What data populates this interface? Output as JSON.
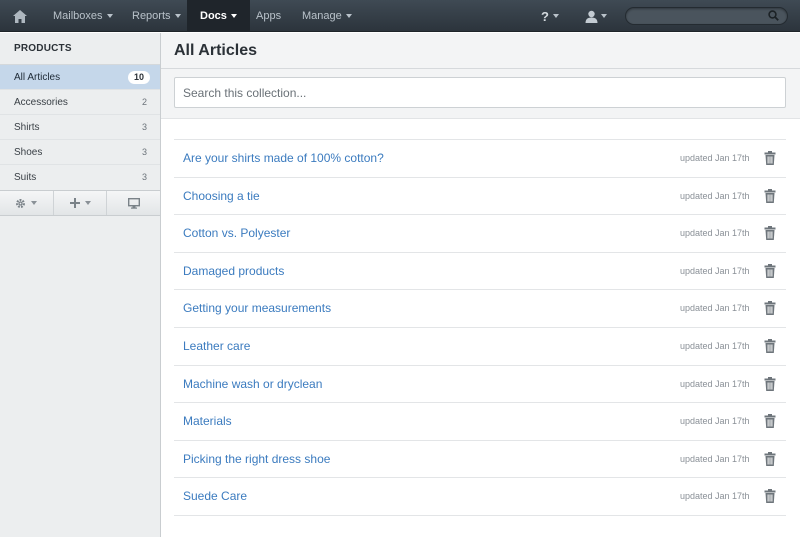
{
  "nav": {
    "items": [
      {
        "label": "Mailboxes",
        "has_caret": true
      },
      {
        "label": "Reports",
        "has_caret": true
      },
      {
        "label": "Docs",
        "has_caret": true,
        "active": true
      },
      {
        "label": "Apps",
        "has_caret": false
      },
      {
        "label": "Manage",
        "has_caret": true
      }
    ],
    "help_label": "?",
    "search_placeholder": "",
    "icons": {
      "home": "home-icon",
      "user": "user-icon",
      "search": "search-icon"
    }
  },
  "sidebar": {
    "heading": "PRODUCTS",
    "items": [
      {
        "label": "All Articles",
        "count": "10",
        "active": true
      },
      {
        "label": "Accessories",
        "count": "2"
      },
      {
        "label": "Shirts",
        "count": "3"
      },
      {
        "label": "Shoes",
        "count": "3"
      },
      {
        "label": "Suits",
        "count": "3"
      }
    ],
    "toolbar_icons": [
      "gear-icon",
      "plus-icon",
      "monitor-icon"
    ]
  },
  "main": {
    "title": "All Articles",
    "search_placeholder": "Search this collection...",
    "articles": [
      {
        "title": "Are your shirts made of 100% cotton?",
        "updated": "updated Jan 17th"
      },
      {
        "title": "Choosing a tie",
        "updated": "updated Jan 17th"
      },
      {
        "title": "Cotton vs. Polyester",
        "updated": "updated Jan 17th"
      },
      {
        "title": "Damaged products",
        "updated": "updated Jan 17th"
      },
      {
        "title": "Getting your measurements",
        "updated": "updated Jan 17th"
      },
      {
        "title": "Leather care",
        "updated": "updated Jan 17th"
      },
      {
        "title": "Machine wash or dryclean",
        "updated": "updated Jan 17th"
      },
      {
        "title": "Materials",
        "updated": "updated Jan 17th"
      },
      {
        "title": "Picking the right dress shoe",
        "updated": "updated Jan 17th"
      },
      {
        "title": "Suede Care",
        "updated": "updated Jan 17th"
      }
    ]
  },
  "colors": {
    "nav_bg": "#2f373f",
    "link": "#3b7bbf",
    "sidebar_active": "#c5d7ea"
  }
}
